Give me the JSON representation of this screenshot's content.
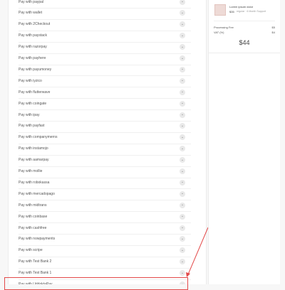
{
  "payment_methods": [
    "Pay with paypal",
    "Pay with wallet",
    "Pay with 2Checkout",
    "Pay with paystack",
    "Pay with razorpay",
    "Pay with payhere",
    "Pay with payumoney",
    "Pay with iyzico",
    "Pay with flutterwave",
    "Pay with coingate",
    "Pay with ipay",
    "Pay with payfast",
    "Pay with companymerns",
    "Pay with instamojo",
    "Pay with aamarpay",
    "Pay with mollie",
    "Pay with robokassa",
    "Pay with mercadopago",
    "Pay with midtrans",
    "Pay with coinbase",
    "Pay with cashfree",
    "Pay with nowpayments",
    "Pay with scripe",
    "Pay with Test Bank 2",
    "Pay with Test Bank 1",
    "Pay with UddoktaPay"
  ],
  "chevron_icon": "chevron-down-icon",
  "summary": {
    "product_title": "Lorem ipsum dolor",
    "product_price": "$35",
    "product_meta": "regular · 6 Month Support",
    "processing_fee_label": "Processing Fee",
    "processing_fee_value": "$5",
    "vat_label": "VAT (%)",
    "vat_value": "$4",
    "total": "$44"
  },
  "colors": {
    "highlight": "#e34a4a",
    "background": "#f7f7f7",
    "panel": "#ffffff"
  }
}
